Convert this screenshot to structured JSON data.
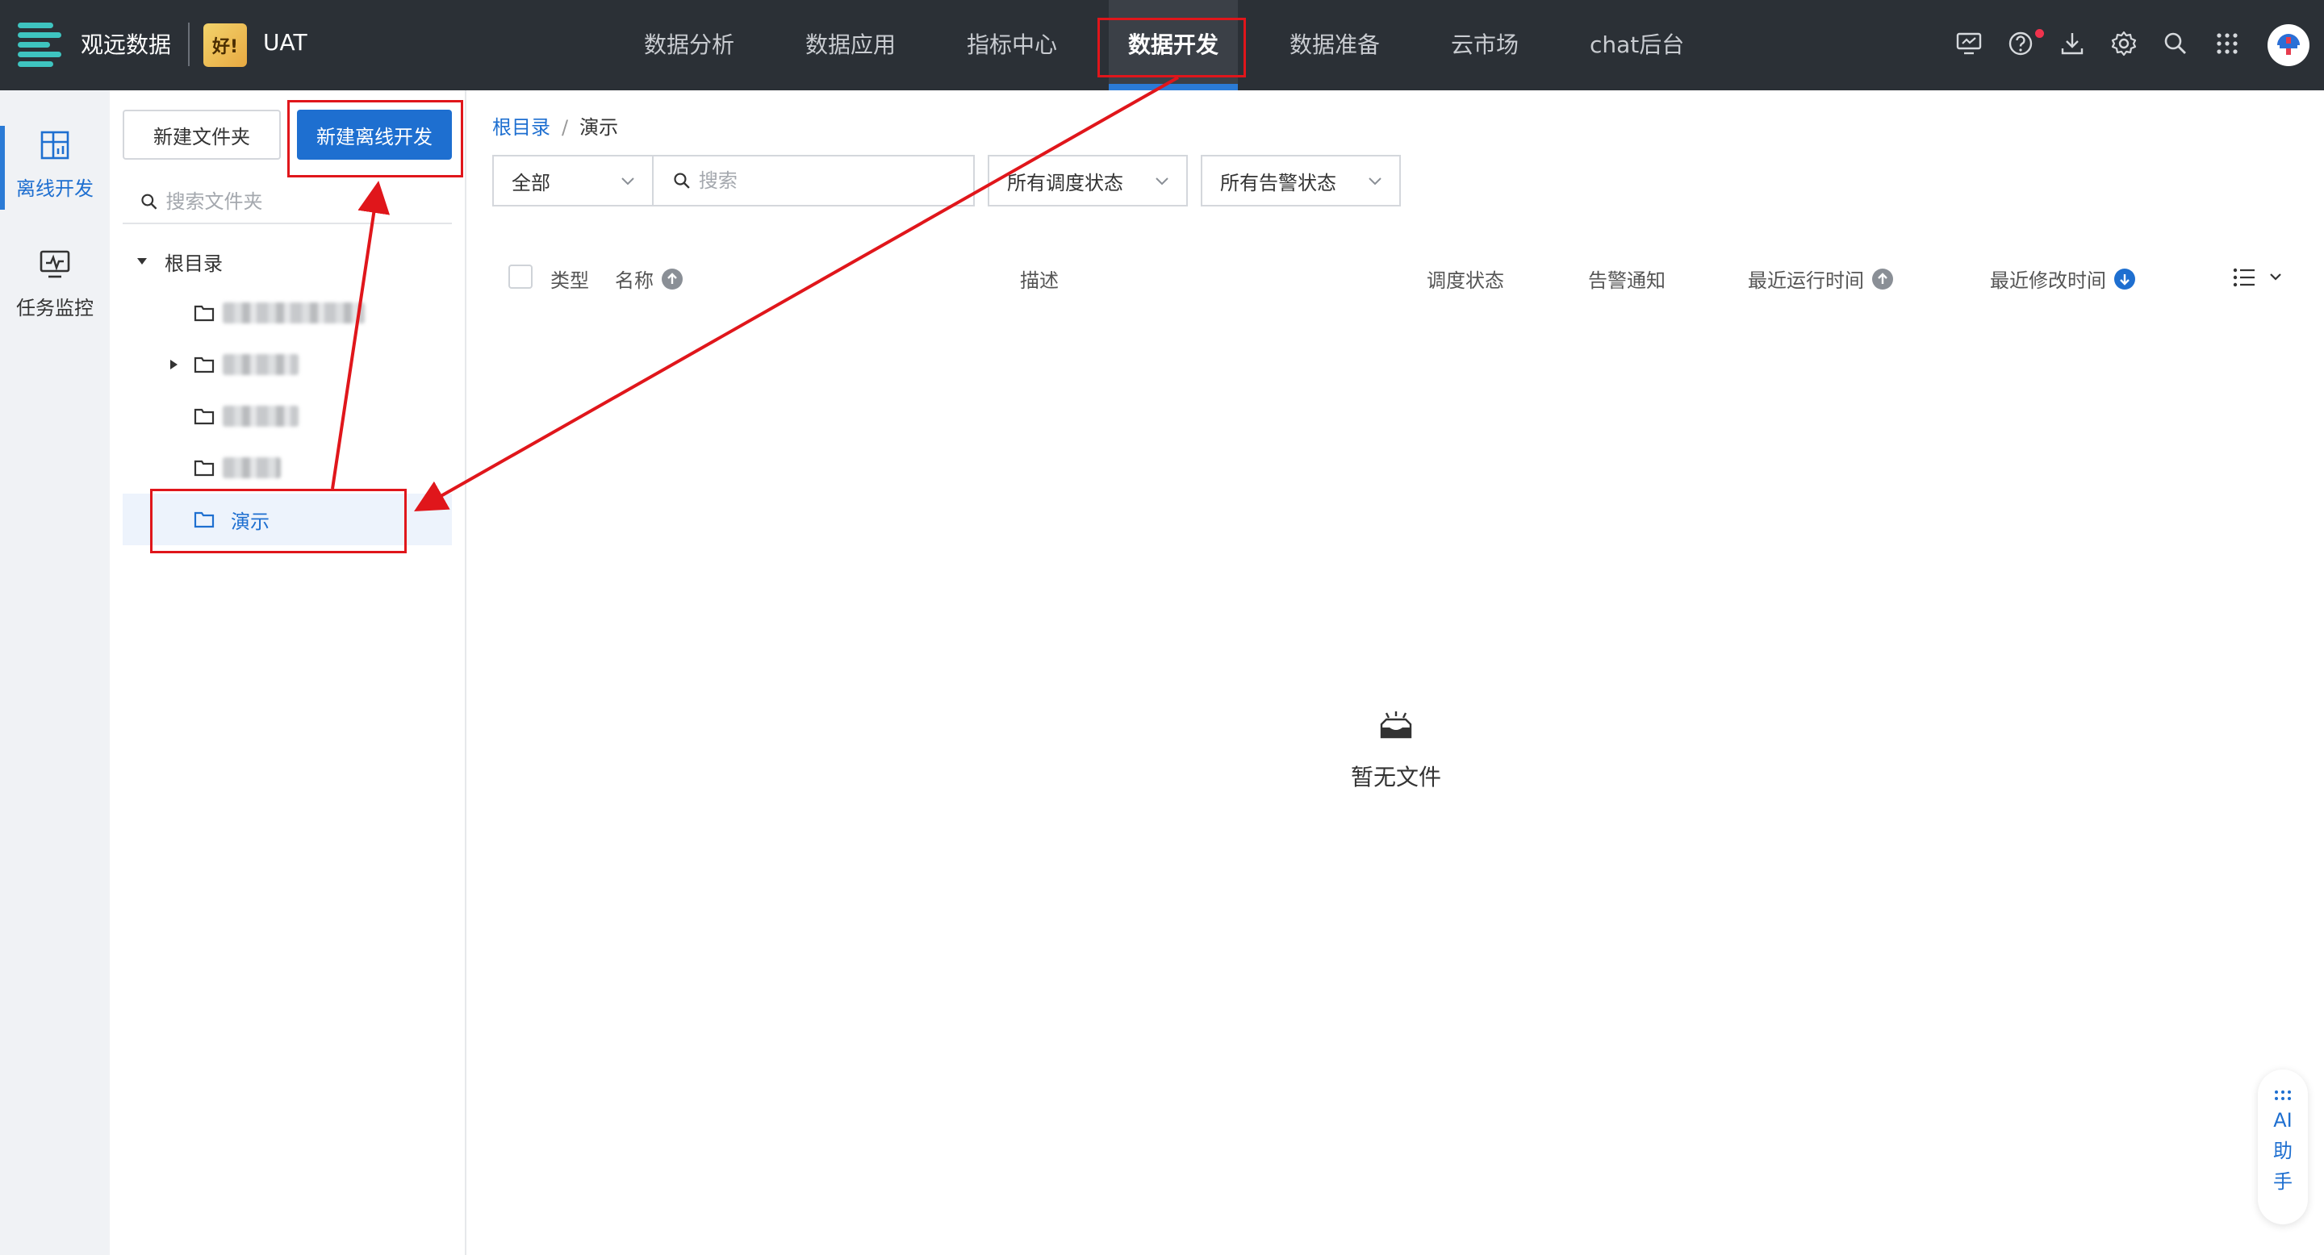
{
  "app": {
    "brand": "观远数据",
    "env": "UAT",
    "tile_text": "好!"
  },
  "nav": {
    "items": [
      {
        "label": "数据分析"
      },
      {
        "label": "数据应用"
      },
      {
        "label": "指标中心"
      },
      {
        "label": "数据开发",
        "active": true
      },
      {
        "label": "数据准备"
      },
      {
        "label": "云市场"
      },
      {
        "label": "chat后台"
      }
    ],
    "icons": [
      "monitor-icon",
      "help-icon",
      "download-icon",
      "gear-icon",
      "search-icon",
      "apps-grid-icon",
      "user-avatar"
    ]
  },
  "rail": {
    "items": [
      {
        "label": "离线开发",
        "icon": "offline-dev-icon",
        "active": true
      },
      {
        "label": "任务监控",
        "icon": "task-monitor-icon"
      }
    ]
  },
  "panel": {
    "new_folder": "新建文件夹",
    "new_offline": "新建离线开发",
    "search_placeholder": "搜索文件夹",
    "root_label": "根目录",
    "selected_folder": "演示"
  },
  "breadcrumb": {
    "root": "根目录",
    "separator": "/",
    "current": "演示"
  },
  "filters": {
    "type": "全部",
    "search_placeholder": "搜索",
    "schedule": "所有调度状态",
    "alert": "所有告警状态"
  },
  "table": {
    "headers": {
      "type": "类型",
      "name": "名称",
      "desc": "描述",
      "schedule": "调度状态",
      "alert": "告警通知",
      "last_run": "最近运行时间",
      "last_modified": "最近修改时间"
    }
  },
  "empty": {
    "text": "暂无文件"
  },
  "ai": {
    "c1": "AI",
    "c2": "助",
    "c3": "手"
  },
  "colors": {
    "topbar": "#2b3036",
    "accent": "#1e6fd0",
    "annotation": "#e0161b",
    "logo": "#3ec4c0"
  }
}
